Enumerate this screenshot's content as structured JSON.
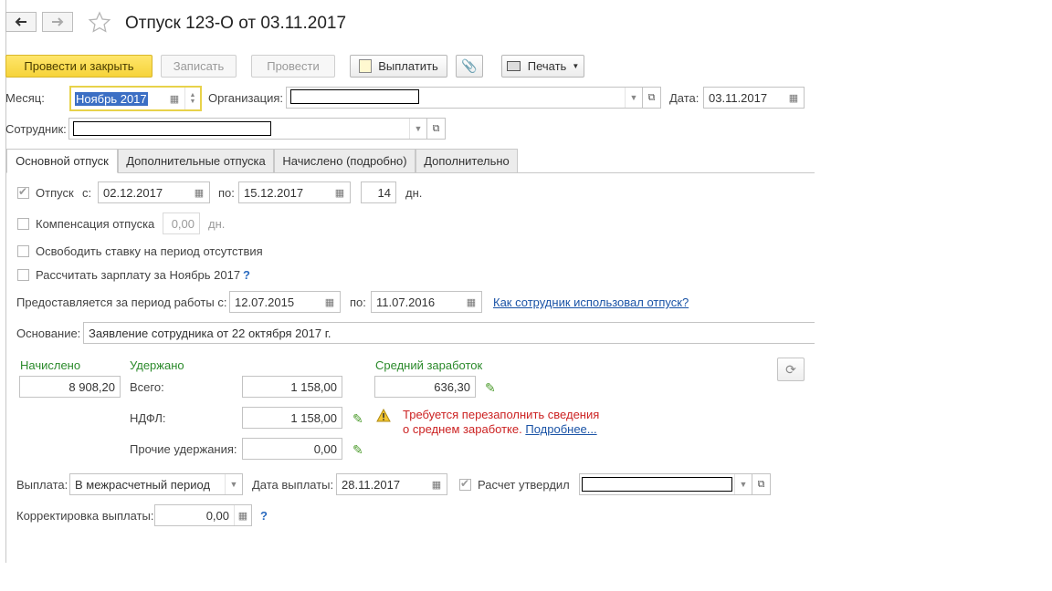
{
  "window": {
    "title": "Отпуск 123-О от 03.11.2017"
  },
  "toolbar": {
    "post_close": "Провести и закрыть",
    "save": "Записать",
    "post": "Провести",
    "pay": "Выплатить",
    "print": "Печать"
  },
  "header": {
    "month_label": "Месяц:",
    "month_value": "Ноябрь 2017",
    "org_label": "Организация:",
    "date_label": "Дата:",
    "date_value": "03.11.2017",
    "employee_label": "Сотрудник:"
  },
  "tabs": [
    {
      "label": "Основной отпуск",
      "active": true
    },
    {
      "label": "Дополнительные отпуска",
      "active": false
    },
    {
      "label": "Начислено (подробно)",
      "active": false
    },
    {
      "label": "Дополнительно",
      "active": false
    }
  ],
  "vacation": {
    "label": "Отпуск",
    "from_label": "с:",
    "from": "02.12.2017",
    "to_label": "по:",
    "to": "15.12.2017",
    "days": "14",
    "days_unit": "дн.",
    "checked": true
  },
  "compensation": {
    "label": "Компенсация отпуска",
    "value": "0,00",
    "unit": "дн.",
    "checked": false
  },
  "free_rate": {
    "label": "Освободить ставку на период отсутствия",
    "checked": false
  },
  "calc_salary": {
    "label": "Рассчитать зарплату за Ноябрь 2017",
    "help": "?",
    "checked": false
  },
  "period": {
    "label": "Предоставляется за период работы с:",
    "from": "12.07.2015",
    "to_label": "по:",
    "to": "11.07.2016",
    "link": "Как сотрудник использовал отпуск?"
  },
  "basis": {
    "label": "Основание:",
    "value": "Заявление сотрудника от 22 октября 2017 г."
  },
  "accrued": {
    "label": "Начислено",
    "value": "8 908,20"
  },
  "withheld": {
    "label": "Удержано",
    "total_label": "Всего:",
    "total": "1 158,00",
    "ndfl_label": "НДФЛ:",
    "ndfl": "1 158,00",
    "other_label": "Прочие удержания:",
    "other": "0,00"
  },
  "avg_earnings": {
    "label": "Средний заработок",
    "value": "636,30"
  },
  "warning": {
    "line1": "Требуется перезаполнить сведения",
    "line2": "о среднем заработке.",
    "link": "Подробнее..."
  },
  "payment": {
    "label": "Выплата:",
    "value": "В межрасчетный период",
    "date_label": "Дата выплаты:",
    "date": "28.11.2017",
    "approved_label": "Расчет утвердил",
    "approved": true
  },
  "correction": {
    "label": "Корректировка выплаты:",
    "value": "0,00",
    "help": "?"
  },
  "colors": {
    "accent_yellow": "#f6d33a",
    "green_label": "#2b8a2b",
    "warning_red": "#cc2222",
    "link_blue": "#1a53a6"
  }
}
